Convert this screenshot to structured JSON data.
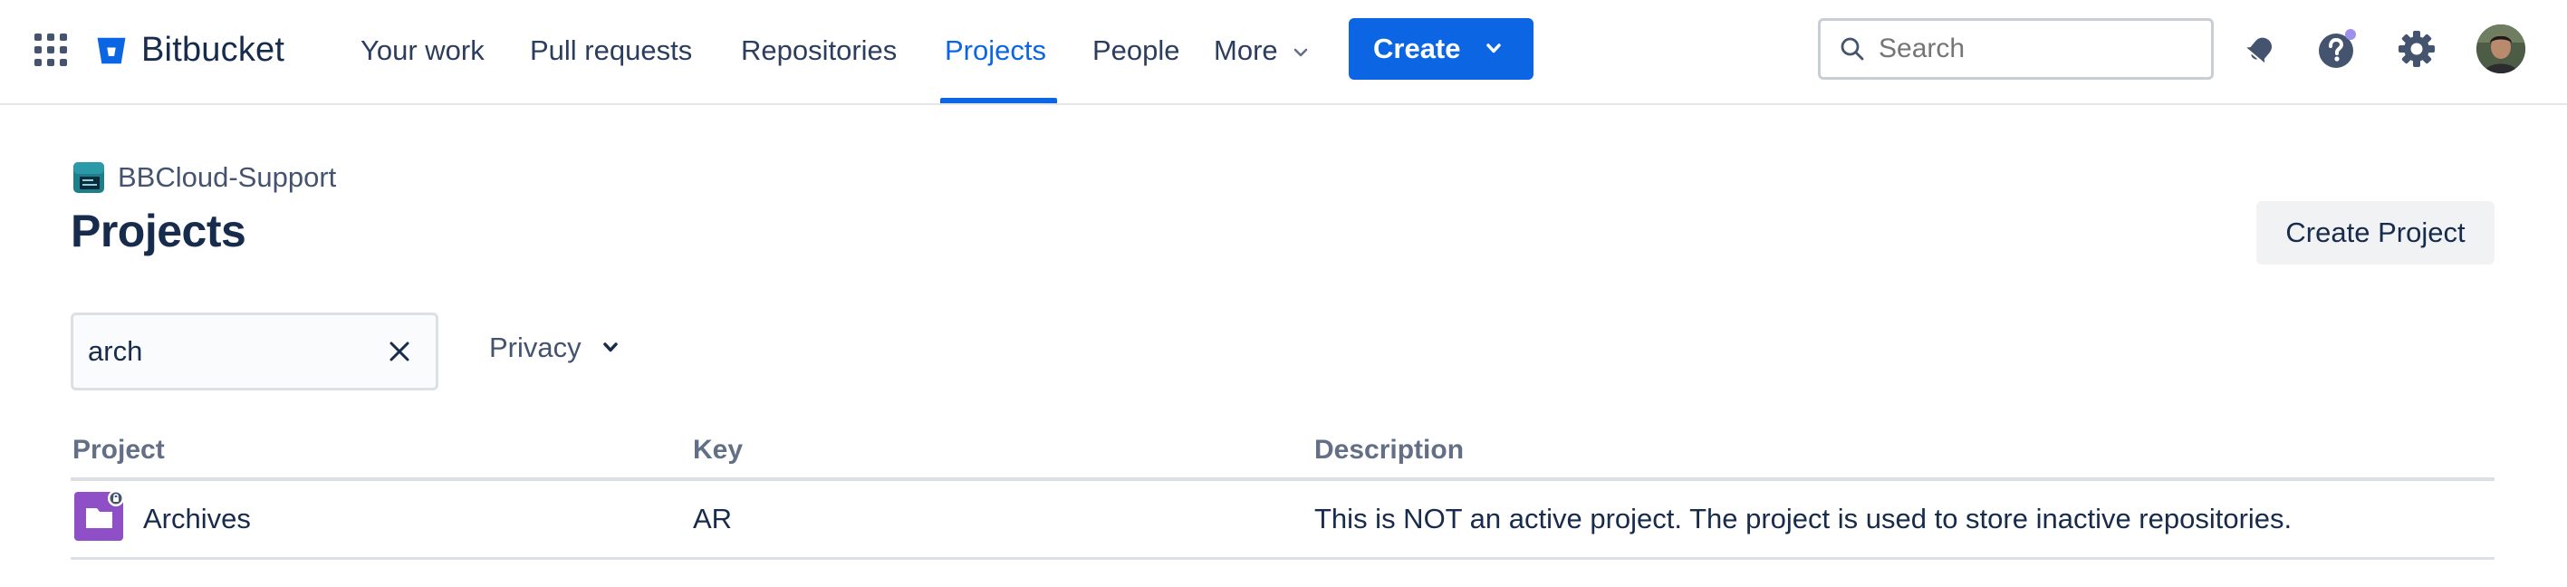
{
  "app": {
    "name": "Bitbucket"
  },
  "nav": {
    "items": [
      {
        "label": "Your work"
      },
      {
        "label": "Pull requests"
      },
      {
        "label": "Repositories"
      },
      {
        "label": "Projects",
        "active": true
      },
      {
        "label": "People"
      },
      {
        "label": "More"
      }
    ],
    "create_label": "Create",
    "search_placeholder": "Search"
  },
  "breadcrumb": {
    "workspace": "BBCloud-Support"
  },
  "page": {
    "title": "Projects",
    "create_project_label": "Create Project"
  },
  "filters": {
    "search_value": "arch",
    "privacy_label": "Privacy"
  },
  "table": {
    "columns": [
      "Project",
      "Key",
      "Description"
    ],
    "rows": [
      {
        "name": "Archives",
        "key": "AR",
        "description": "This is NOT an active project. The project is used to store inactive repositories."
      }
    ]
  },
  "colors": {
    "accent": "#0c66e4",
    "project_icon": "#8f4fc7",
    "notification_dot": "#9f8fef"
  }
}
